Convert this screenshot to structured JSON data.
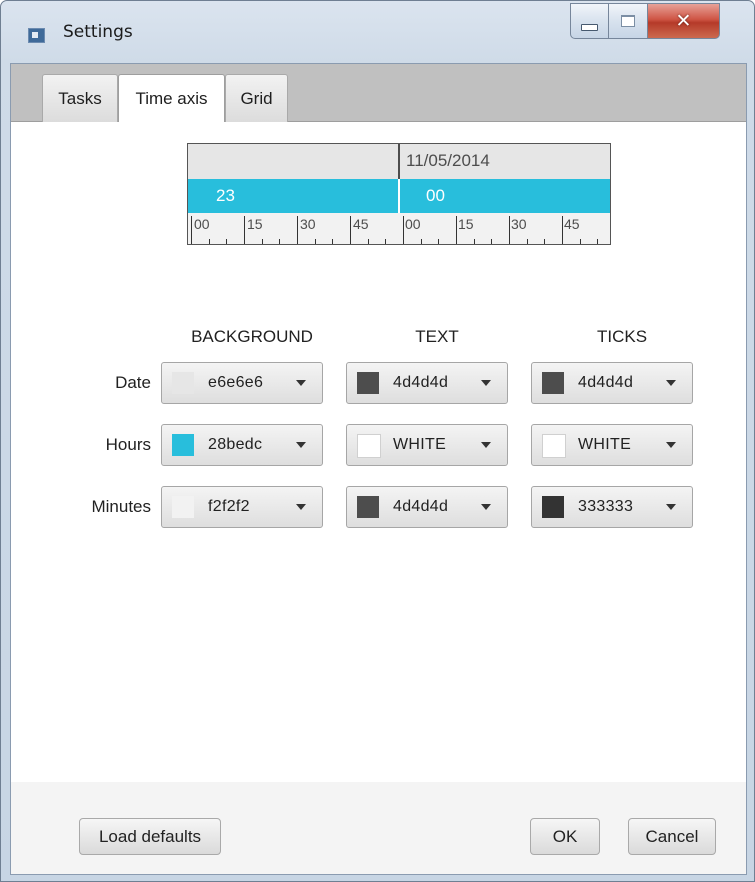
{
  "window": {
    "title": "Settings"
  },
  "tabs": [
    {
      "label": "Tasks"
    },
    {
      "label": "Time axis",
      "selected": true
    },
    {
      "label": "Grid"
    }
  ],
  "preview": {
    "date": "11/05/2014",
    "hours": [
      "23",
      "00"
    ],
    "minutes": [
      "00",
      "15",
      "30",
      "45",
      "00",
      "15",
      "30",
      "45"
    ]
  },
  "columns": [
    "BACKGROUND",
    "TEXT",
    "TICKS"
  ],
  "rows": [
    {
      "label": "Date",
      "background": {
        "value": "e6e6e6",
        "color": "#e6e6e6"
      },
      "text": {
        "value": "4d4d4d",
        "color": "#4d4d4d"
      },
      "ticks": {
        "value": "4d4d4d",
        "color": "#4d4d4d"
      }
    },
    {
      "label": "Hours",
      "background": {
        "value": "28bedc",
        "color": "#28bedc"
      },
      "text": {
        "value": "WHITE",
        "color": "#ffffff"
      },
      "ticks": {
        "value": "WHITE",
        "color": "#ffffff"
      }
    },
    {
      "label": "Minutes",
      "background": {
        "value": "f2f2f2",
        "color": "#f2f2f2"
      },
      "text": {
        "value": "4d4d4d",
        "color": "#4d4d4d"
      },
      "ticks": {
        "value": "333333",
        "color": "#333333"
      }
    }
  ],
  "buttons": {
    "load_defaults": "Load defaults",
    "ok": "OK",
    "cancel": "Cancel"
  }
}
